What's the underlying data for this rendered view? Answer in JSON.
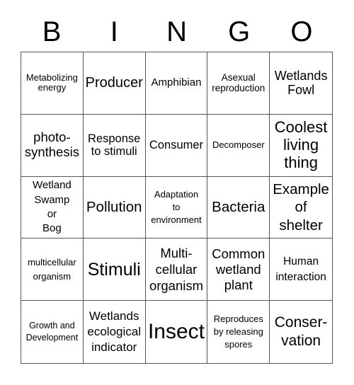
{
  "header": {
    "letters": [
      "B",
      "I",
      "N",
      "G",
      "O"
    ]
  },
  "cells": [
    "Metabolizing\nenergy",
    "Producer",
    "Amphibian",
    "Asexual\nreproduction",
    "Wetlands\nFowl",
    "photo-\nsynthesis",
    "Response\nto stimuli",
    "Consumer",
    "Decomposer",
    "Coolest\nliving\nthing",
    "Wetland\nSwamp\nor\nBog",
    "Pollution",
    "Adaptation\nto\nenvironment",
    "Bacteria",
    "Example\nof\nshelter",
    "multicellular\norganism",
    "Stimuli",
    "Multi-\ncellular\norganism",
    "Common\nwetland\nplant",
    "Human\ninteraction",
    "Growth and\nDevelopment",
    "Wetlands\necological\nindicator",
    "Insect",
    "Reproduces\nby releasing\nspores",
    "Conser-\nvation"
  ]
}
